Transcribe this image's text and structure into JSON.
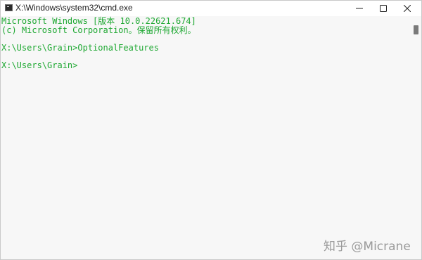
{
  "window": {
    "title": "X:\\Windows\\system32\\cmd.exe",
    "app_icon": "cmd-icon"
  },
  "controls": {
    "minimize_icon": "minimize-icon",
    "maximize_icon": "maximize-icon",
    "close_icon": "close-icon"
  },
  "console": {
    "lines": [
      "Microsoft Windows [版本 10.0.22621.674]",
      "(c) Microsoft Corporation。保留所有权利。",
      "X:\\Users\\Grain>OptionalFeatures",
      "X:\\Users\\Grain>"
    ],
    "text_color": "#1ea832",
    "background_color": "#f7f7f7"
  },
  "watermark": {
    "text": "知乎 @Micrane"
  }
}
